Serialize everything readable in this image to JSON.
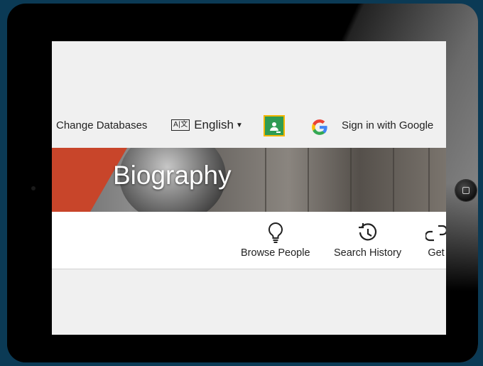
{
  "topbar": {
    "change_databases": "Change Databases",
    "language_icon": "translate-icon",
    "language_label": "English",
    "classroom_icon": "google-classroom-icon",
    "google_icon": "google-g-icon",
    "signin_label": "Sign in with Google"
  },
  "banner": {
    "title": "Biography"
  },
  "nav": {
    "items": [
      {
        "label": "Browse People",
        "icon": "lightbulb-icon"
      },
      {
        "label": "Search History",
        "icon": "history-icon"
      },
      {
        "label": "Get",
        "icon": "link-icon"
      }
    ]
  },
  "colors": {
    "banner_red": "#c8452a",
    "classroom_green": "#2e9b53",
    "classroom_border": "#f2b600"
  }
}
